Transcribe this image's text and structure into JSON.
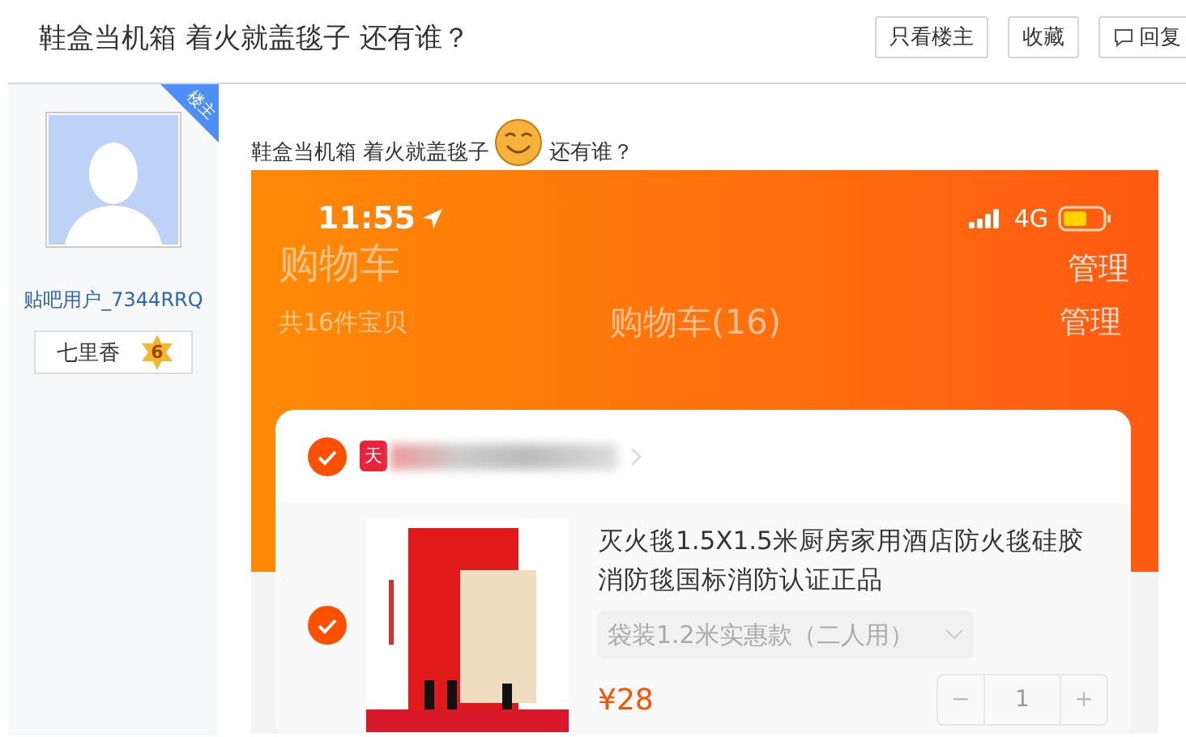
{
  "thread": {
    "title": "鞋盒当机箱 着火就盖毯子 还有谁？",
    "buttons": [
      {
        "label": "只看楼主",
        "kind": "plain"
      },
      {
        "label": "收藏",
        "kind": "plain"
      },
      {
        "label": "回复",
        "kind": "reply"
      }
    ]
  },
  "author": {
    "badge": "楼主",
    "username": "贴吧用户_7344RRQ",
    "title": "七里香",
    "level": "6"
  },
  "post": {
    "text_before": "鞋盒当机箱 着火就盖毯子",
    "text_after": "还有谁？",
    "screenshot": {
      "time": "11:55",
      "network": "4G",
      "heading_large": "购物车",
      "manage_top": "管理",
      "summary": "共16件宝贝",
      "nav_title": "购物车(16)",
      "manage": "管理",
      "store": {
        "checked": true,
        "tag": "天"
      },
      "item": {
        "checked": true,
        "title": "灭火毯1.5X1.5米厨房家用酒店防火毯硅胶消防毯国标消防认证正品",
        "variant": "袋装1.2米实惠款（二人用）",
        "price": "¥28",
        "quantity": "1",
        "minus": "−",
        "plus": "+"
      }
    }
  }
}
